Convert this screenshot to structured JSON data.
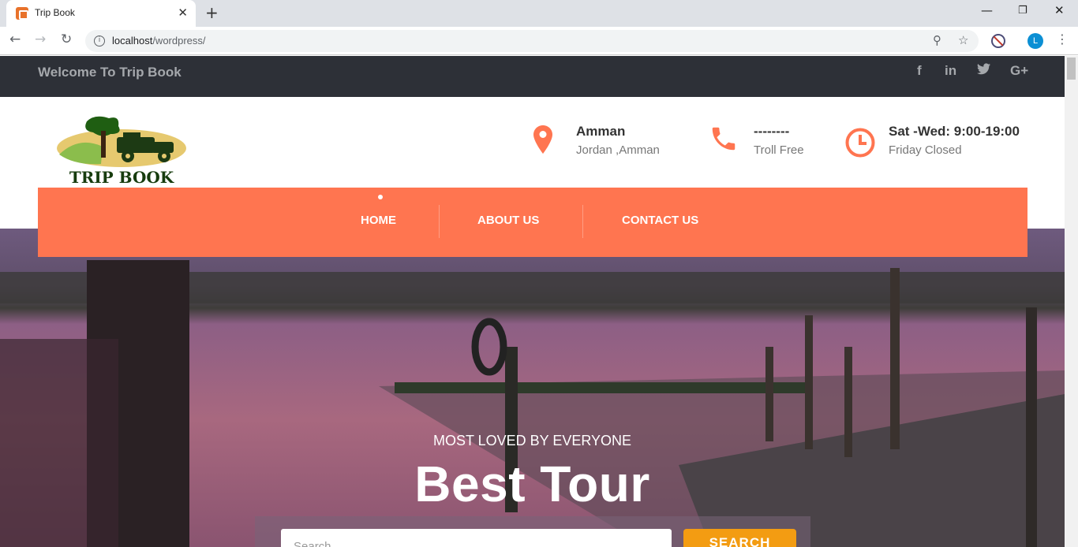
{
  "browser": {
    "tab_title": "Trip Book",
    "url_host": "localhost",
    "url_path": "/wordpress/",
    "profile_initial": "L"
  },
  "topbar": {
    "welcome": "Welcome To Trip Book",
    "social": [
      {
        "name": "facebook-icon",
        "glyph": "f"
      },
      {
        "name": "linkedin-icon",
        "glyph": "in"
      },
      {
        "name": "twitter-icon",
        "glyph": "🐦"
      },
      {
        "name": "google-plus-icon",
        "glyph": "G+"
      }
    ]
  },
  "logo": {
    "text": "TRIP BOOK"
  },
  "header_info": [
    {
      "icon": "location-pin-icon",
      "title": "Amman",
      "sub": "Jordan ,Amman"
    },
    {
      "icon": "phone-icon",
      "title": "--------",
      "sub": "Troll Free"
    },
    {
      "icon": "clock-icon",
      "title": "Sat -Wed: 9:00-19:00",
      "sub": "Friday Closed"
    }
  ],
  "nav": {
    "items": [
      "HOME",
      "ABOUT US",
      "CONTACT US"
    ]
  },
  "hero": {
    "subtitle": "MOST LOVED BY EVERYONE",
    "title": "Best Tour"
  },
  "search": {
    "placeholder": "Search",
    "button_label": "SEARCH"
  },
  "colors": {
    "accent": "#ff7550",
    "topbar": "#2d3037",
    "search_button": "#f39c12"
  }
}
